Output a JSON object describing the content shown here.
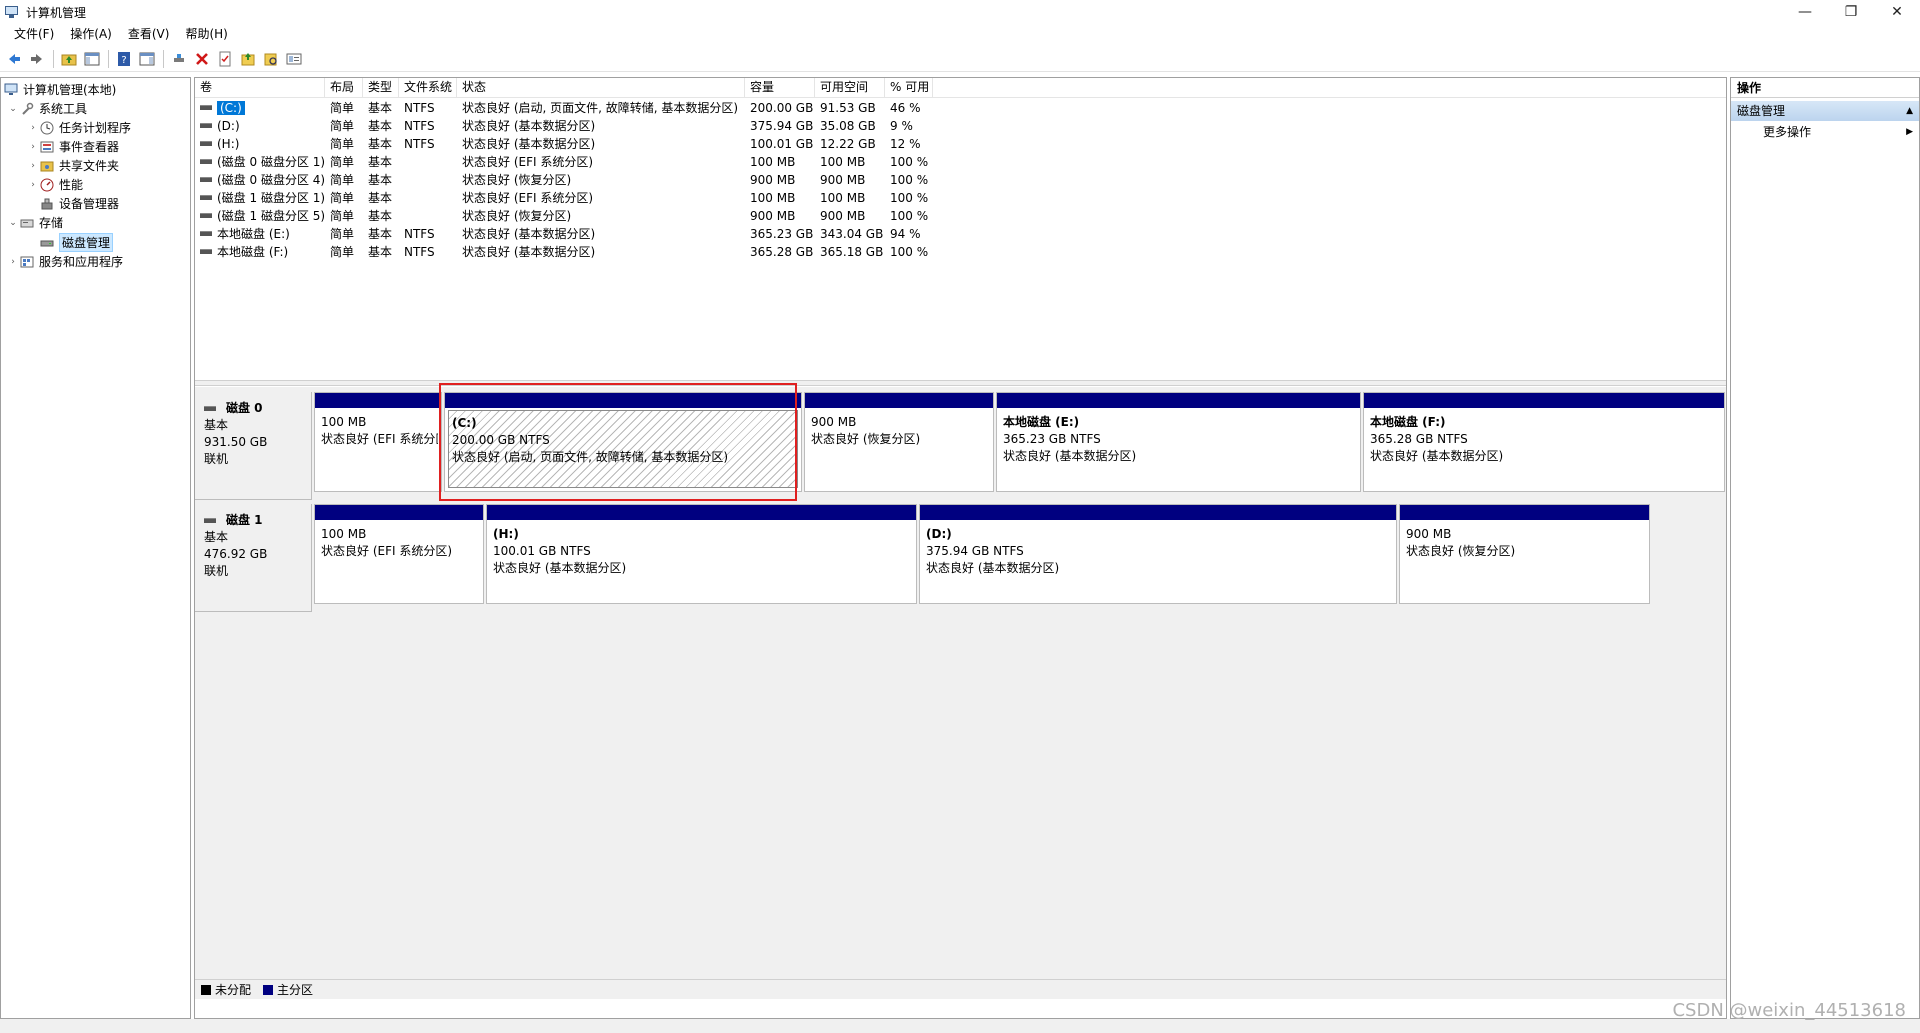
{
  "window": {
    "title": "计算机管理",
    "minimize": "—",
    "restore": "❐",
    "close": "✕"
  },
  "menu": [
    "文件(F)",
    "操作(A)",
    "查看(V)",
    "帮助(H)"
  ],
  "tree": {
    "root": "计算机管理(本地)",
    "system_tools": "系统工具",
    "task_scheduler": "任务计划程序",
    "event_viewer": "事件查看器",
    "shared_folders": "共享文件夹",
    "performance": "性能",
    "device_manager": "设备管理器",
    "storage": "存储",
    "disk_management": "磁盘管理",
    "services_apps": "服务和应用程序"
  },
  "volume_table": {
    "headers": [
      "卷",
      "布局",
      "类型",
      "文件系统",
      "状态",
      "容量",
      "可用空间",
      "% 可用"
    ],
    "rows": [
      [
        "(C:)",
        "简单",
        "基本",
        "NTFS",
        "状态良好 (启动, 页面文件, 故障转储, 基本数据分区)",
        "200.00 GB",
        "91.53 GB",
        "46 %"
      ],
      [
        "(D:)",
        "简单",
        "基本",
        "NTFS",
        "状态良好 (基本数据分区)",
        "375.94 GB",
        "35.08 GB",
        "9 %"
      ],
      [
        "(H:)",
        "简单",
        "基本",
        "NTFS",
        "状态良好 (基本数据分区)",
        "100.01 GB",
        "12.22 GB",
        "12 %"
      ],
      [
        "(磁盘 0 磁盘分区 1)",
        "简单",
        "基本",
        "",
        "状态良好 (EFI 系统分区)",
        "100 MB",
        "100 MB",
        "100 %"
      ],
      [
        "(磁盘 0 磁盘分区 4)",
        "简单",
        "基本",
        "",
        "状态良好 (恢复分区)",
        "900 MB",
        "900 MB",
        "100 %"
      ],
      [
        "(磁盘 1 磁盘分区 1)",
        "简单",
        "基本",
        "",
        "状态良好 (EFI 系统分区)",
        "100 MB",
        "100 MB",
        "100 %"
      ],
      [
        "(磁盘 1 磁盘分区 5)",
        "简单",
        "基本",
        "",
        "状态良好 (恢复分区)",
        "900 MB",
        "900 MB",
        "100 %"
      ],
      [
        "本地磁盘 (E:)",
        "简单",
        "基本",
        "NTFS",
        "状态良好 (基本数据分区)",
        "365.23 GB",
        "343.04 GB",
        "94 %"
      ],
      [
        "本地磁盘 (F:)",
        "简单",
        "基本",
        "NTFS",
        "状态良好 (基本数据分区)",
        "365.28 GB",
        "365.18 GB",
        "100 %"
      ]
    ]
  },
  "disks": [
    {
      "name": "磁盘 0",
      "type": "基本",
      "size": "931.50 GB",
      "state": "联机",
      "partitions": [
        {
          "name": "",
          "size": "100 MB",
          "status": "状态良好 (EFI 系统分区)"
        },
        {
          "name": "(C:)",
          "size": "200.00 GB NTFS",
          "status": "状态良好 (启动, 页面文件, 故障转储, 基本数据分区)"
        },
        {
          "name": "",
          "size": "900 MB",
          "status": "状态良好 (恢复分区)"
        },
        {
          "name": "本地磁盘  (E:)",
          "size": "365.23 GB NTFS",
          "status": "状态良好 (基本数据分区)"
        },
        {
          "name": "本地磁盘  (F:)",
          "size": "365.28 GB NTFS",
          "status": "状态良好 (基本数据分区)"
        }
      ]
    },
    {
      "name": "磁盘 1",
      "type": "基本",
      "size": "476.92 GB",
      "state": "联机",
      "partitions": [
        {
          "name": "",
          "size": "100 MB",
          "status": "状态良好 (EFI 系统分区)"
        },
        {
          "name": "(H:)",
          "size": "100.01 GB NTFS",
          "status": "状态良好 (基本数据分区)"
        },
        {
          "name": "(D:)",
          "size": "375.94 GB NTFS",
          "status": "状态良好 (基本数据分区)"
        },
        {
          "name": "",
          "size": "900 MB",
          "status": "状态良好 (恢复分区)"
        }
      ]
    }
  ],
  "legend": {
    "unallocated": "未分配",
    "primary": "主分区",
    "unallocated_color": "#000000",
    "primary_color": "#000080"
  },
  "actions": {
    "header": "操作",
    "section": "磁盘管理",
    "more": "更多操作",
    "collapse_glyph": "▲",
    "more_glyph": "▶"
  },
  "watermark": "CSDN @weixin_44513618"
}
